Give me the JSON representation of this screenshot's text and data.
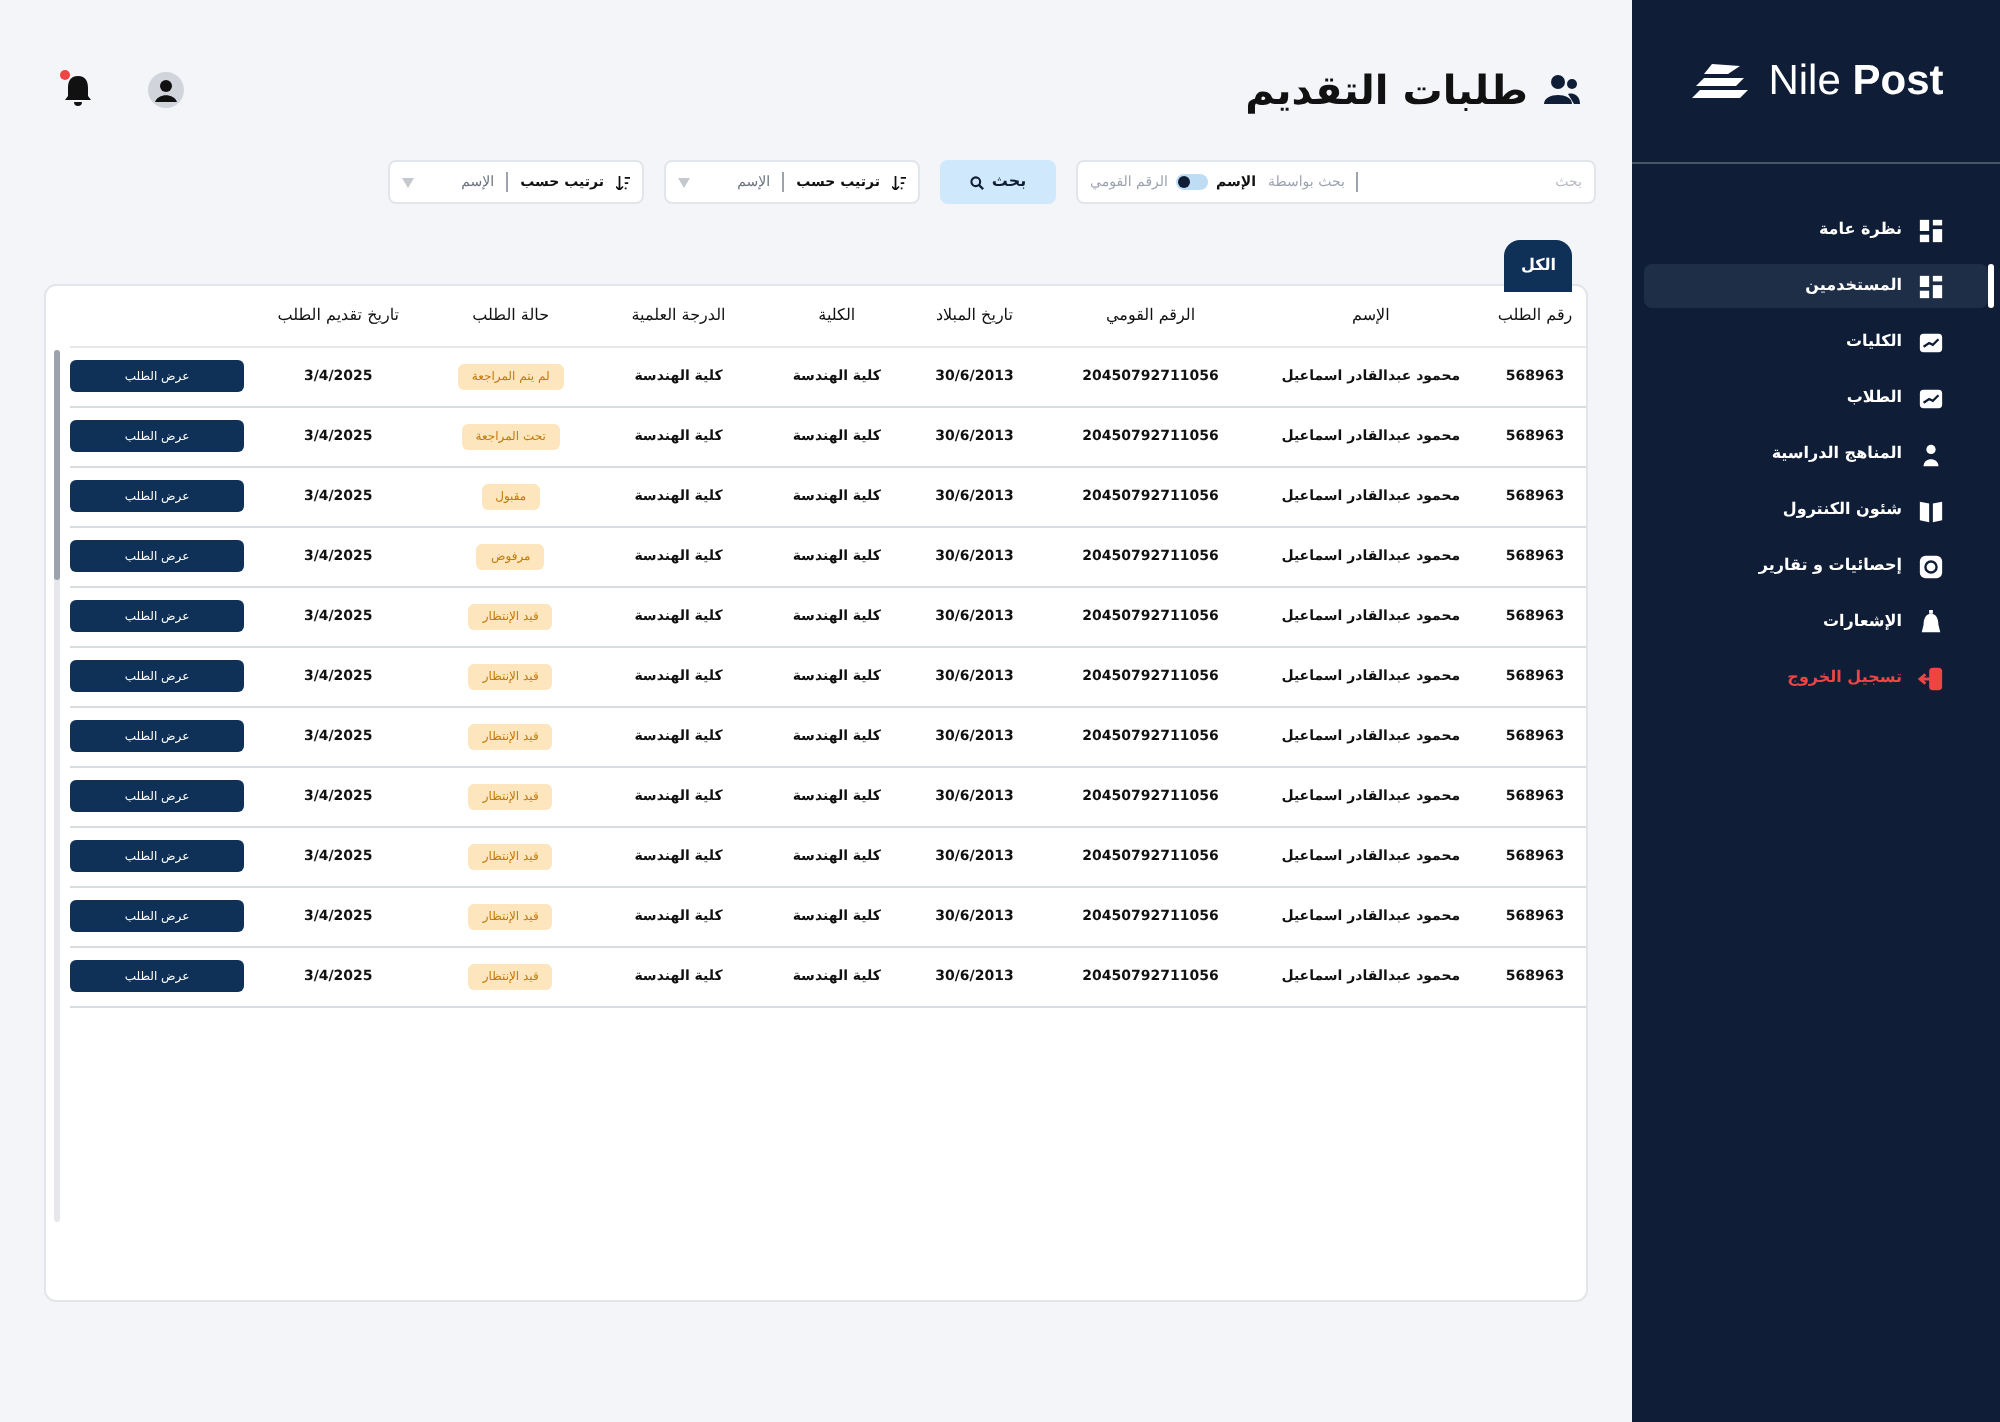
{
  "sidebar": {
    "logo": {
      "light": "Nile",
      "bold": "Post"
    },
    "items": [
      {
        "label": "نظرة عامة",
        "selected": false,
        "kind": "normal"
      },
      {
        "label": "المستخدمين",
        "selected": true,
        "kind": "normal"
      },
      {
        "label": "الكليات",
        "selected": false,
        "kind": "normal"
      },
      {
        "label": "الطلاب",
        "selected": false,
        "kind": "normal"
      },
      {
        "label": "المناهج الدراسية",
        "selected": false,
        "kind": "normal"
      },
      {
        "label": "شئون الكنترول",
        "selected": false,
        "kind": "normal"
      },
      {
        "label": "إحصائيات و تقارير",
        "selected": false,
        "kind": "normal"
      },
      {
        "label": "الإشعارات",
        "selected": false,
        "kind": "normal"
      },
      {
        "label": "تسجيل الخروج",
        "selected": false,
        "kind": "danger"
      }
    ]
  },
  "header": {
    "title": "طلبات التقديم",
    "notification_dot": true
  },
  "search": {
    "placeholder": "بحث",
    "by_label": "بحث بواسطة",
    "toggle_on": false,
    "options": [
      {
        "label": "الإسم",
        "selected": true
      },
      {
        "label": "الرقم القومي",
        "selected": false
      }
    ],
    "button": "بحث"
  },
  "sorts": [
    {
      "label": "ترتيب حسب",
      "value": "الإسم"
    },
    {
      "label": "ترتيب حسب",
      "value": "الإسم"
    }
  ],
  "tabs": [
    {
      "label": "الكل",
      "selected": true
    }
  ],
  "table": {
    "columns": [
      "رقم الطلب",
      "الإسم",
      "الرقم القومي",
      "تاريخ المبلاد",
      "الكلية",
      "الدرجة العلمية",
      "حالة الطلب",
      "تاريخ تقديم الطلب"
    ],
    "rows": [
      {
        "id": "568963",
        "name": "محمود عبدالقادر اسماعيل",
        "national_id": "20450792711056",
        "birth": "30/6/2013",
        "faculty": "كلية الهندسة",
        "degree": "كلية الهندسة",
        "status": "لم يتم المراجعة",
        "date": "3/4/2025",
        "action": "عرض الطلب"
      },
      {
        "id": "568963",
        "name": "محمود عبدالقادر اسماعيل",
        "national_id": "20450792711056",
        "birth": "30/6/2013",
        "faculty": "كلية الهندسة",
        "degree": "كلية الهندسة",
        "status": "تحت المراجعة",
        "date": "3/4/2025",
        "action": "عرض الطلب"
      },
      {
        "id": "568963",
        "name": "محمود عبدالقادر اسماعيل",
        "national_id": "20450792711056",
        "birth": "30/6/2013",
        "faculty": "كلية الهندسة",
        "degree": "كلية الهندسة",
        "status": "مقبول",
        "date": "3/4/2025",
        "action": "عرض الطلب"
      },
      {
        "id": "568963",
        "name": "محمود عبدالقادر اسماعيل",
        "national_id": "20450792711056",
        "birth": "30/6/2013",
        "faculty": "كلية الهندسة",
        "degree": "كلية الهندسة",
        "status": "مرفوض",
        "date": "3/4/2025",
        "action": "عرض الطلب"
      },
      {
        "id": "568963",
        "name": "محمود عبدالقادر اسماعيل",
        "national_id": "20450792711056",
        "birth": "30/6/2013",
        "faculty": "كلية الهندسة",
        "degree": "كلية الهندسة",
        "status": "قيد الإنتظار",
        "date": "3/4/2025",
        "action": "عرض الطلب"
      },
      {
        "id": "568963",
        "name": "محمود عبدالقادر اسماعيل",
        "national_id": "20450792711056",
        "birth": "30/6/2013",
        "faculty": "كلية الهندسة",
        "degree": "كلية الهندسة",
        "status": "قيد الإنتظار",
        "date": "3/4/2025",
        "action": "عرض الطلب"
      },
      {
        "id": "568963",
        "name": "محمود عبدالقادر اسماعيل",
        "national_id": "20450792711056",
        "birth": "30/6/2013",
        "faculty": "كلية الهندسة",
        "degree": "كلية الهندسة",
        "status": "قيد الإنتظار",
        "date": "3/4/2025",
        "action": "عرض الطلب"
      },
      {
        "id": "568963",
        "name": "محمود عبدالقادر اسماعيل",
        "national_id": "20450792711056",
        "birth": "30/6/2013",
        "faculty": "كلية الهندسة",
        "degree": "كلية الهندسة",
        "status": "قيد الإنتظار",
        "date": "3/4/2025",
        "action": "عرض الطلب"
      },
      {
        "id": "568963",
        "name": "محمود عبدالقادر اسماعيل",
        "national_id": "20450792711056",
        "birth": "30/6/2013",
        "faculty": "كلية الهندسة",
        "degree": "كلية الهندسة",
        "status": "قيد الإنتظار",
        "date": "3/4/2025",
        "action": "عرض الطلب"
      },
      {
        "id": "568963",
        "name": "محمود عبدالقادر اسماعيل",
        "national_id": "20450792711056",
        "birth": "30/6/2013",
        "faculty": "كلية الهندسة",
        "degree": "كلية الهندسة",
        "status": "قيد الإنتظار",
        "date": "3/4/2025",
        "action": "عرض الطلب"
      },
      {
        "id": "568963",
        "name": "محمود عبدالقادر اسماعيل",
        "national_id": "20450792711056",
        "birth": "30/6/2013",
        "faculty": "كلية الهندسة",
        "degree": "كلية الهندسة",
        "status": "قيد الإنتظار",
        "date": "3/4/2025",
        "action": "عرض الطلب"
      }
    ]
  }
}
